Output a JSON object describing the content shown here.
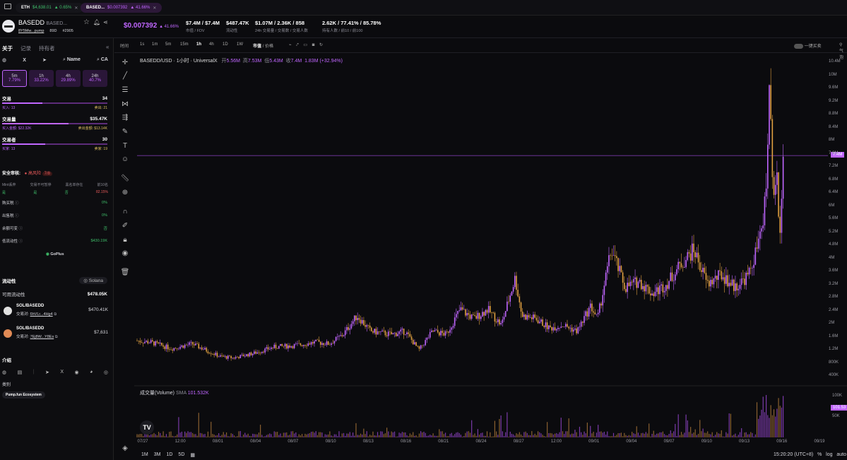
{
  "tabs": [
    {
      "symbol": "ETH",
      "price": "$4,638.01",
      "change": "▲ 0.65%"
    },
    {
      "symbol": "BASED...",
      "price": "$0.007392",
      "change": "▲ 41.66%"
    }
  ],
  "token": {
    "name": "BASEDD",
    "subname": "BASED...",
    "address": "8Y5Mw...pump",
    "age": "89D",
    "rank": "#2905"
  },
  "header": {
    "price": "$0.007392",
    "price_change": "▲ 41.66%",
    "mcap_value": "$7.4M / $7.4M",
    "mcap_label": "市值 / FDV",
    "liq_value": "$487.47K",
    "liq_label": "流动性",
    "vol_value": "$1.07M / 2.36K / 858",
    "vol_label": "24h 交易量 / 交易数 / 交易人数",
    "holders_value": "2.62K / 77.41% / 85.78%",
    "holders_label": "持有人数 / 前10 / 前100"
  },
  "sidebar": {
    "tabs": [
      "关于",
      "记录",
      "持有者"
    ],
    "social": {
      "name": "Name",
      "ca": "CA"
    },
    "timeframes": [
      {
        "label": "5m",
        "value": "7.79%"
      },
      {
        "label": "1h",
        "value": "33.22%"
      },
      {
        "label": "4h",
        "value": "29.89%"
      },
      {
        "label": "24h",
        "value": "40.7%"
      }
    ],
    "stats": [
      {
        "label": "交易",
        "value": "34",
        "left": "买入: 13",
        "right": "卖出: 21",
        "fill": 0.38
      },
      {
        "label": "交易量",
        "value": "$35.47K",
        "left": "买入金额: $22.32K",
        "right": "卖出金额: $13.14K",
        "fill": 0.63
      },
      {
        "label": "交易者",
        "value": "30",
        "left": "买家: 13",
        "right": "卖家: 19",
        "fill": 0.41
      }
    ],
    "security": {
      "title": "安全审核:",
      "badge": "高风险",
      "score": "7/8",
      "cols": [
        "Mint丢弃",
        "交易不可暂停",
        "黑名单存在",
        "前10名"
      ],
      "vals": [
        "是",
        "是",
        "否",
        "82.15%"
      ],
      "rows": [
        {
          "label": "购买税",
          "value": "0%"
        },
        {
          "label": "出售税",
          "value": "0%"
        },
        {
          "label": "余额可变",
          "value": "否"
        },
        {
          "label": "低流动性",
          "value": "$430.19K"
        }
      ],
      "provider": "GoPlus"
    },
    "liquidity": {
      "title": "流动性",
      "chain": "Solana",
      "avail_label": "可用流动性",
      "avail_value": "$478.05K",
      "pairs": [
        {
          "name": "SOL/BASEDD",
          "pair_label": "交易对:",
          "pair": "6hVLr...4Hg4",
          "value": "$470.41K"
        },
        {
          "name": "SOL/BASEDD",
          "pair_label": "交易对:",
          "pair": "7Ej8W...Y8Es",
          "value": "$7,631"
        }
      ]
    },
    "intro": {
      "title": "介绍",
      "category_label": "类别",
      "category": "Pump.fun Ecosystem"
    }
  },
  "chart_toolbar": {
    "time_label": "时间",
    "intervals": [
      "1s",
      "1m",
      "5m",
      "15m",
      "1h",
      "4h",
      "1D",
      "1W"
    ],
    "active": "1h",
    "mode": "市值",
    "mode_alt": "/ 价格",
    "quick_buy": "一键买卖",
    "bubble": "气泡"
  },
  "chart_data": {
    "type": "candlestick",
    "title": "BASEDD/USD · 1小时 · UniversalX",
    "ohlc": {
      "o_label": "开",
      "o": "5.56M",
      "h_label": "高",
      "h": "7.53M",
      "l_label": "低",
      "l": "5.43M",
      "c_label": "收",
      "c": "7.4M",
      "chg": "1.83M (+32.94%)"
    },
    "current_label": "7.4M",
    "y_ticks": [
      "10.4M",
      "10M",
      "9.6M",
      "9.2M",
      "8.8M",
      "8.4M",
      "8M",
      "7.6M",
      "7.2M",
      "6.8M",
      "6.4M",
      "6M",
      "5.6M",
      "5.2M",
      "4.8M",
      "4M",
      "3.6M",
      "3.2M",
      "2.8M",
      "2.4M",
      "2M",
      "1.6M",
      "1.2M",
      "800K",
      "400K"
    ],
    "x_ticks": [
      "07/27",
      "12:00",
      "08/01",
      "08/04",
      "08/07",
      "08/10",
      "08/13",
      "08/16",
      "08/21",
      "08/24",
      "08/27",
      "12:00",
      "09/01",
      "09/04",
      "09/07",
      "09/10",
      "09/13",
      "09/16",
      "09/19"
    ],
    "price_path": [
      [
        0,
        1.5
      ],
      [
        0.02,
        1.45
      ],
      [
        0.05,
        1.25
      ],
      [
        0.08,
        1.4
      ],
      [
        0.1,
        1.2
      ],
      [
        0.12,
        1.0
      ],
      [
        0.14,
        0.95
      ],
      [
        0.17,
        1.1
      ],
      [
        0.2,
        1.3
      ],
      [
        0.23,
        1.35
      ],
      [
        0.26,
        1.45
      ],
      [
        0.28,
        1.4
      ],
      [
        0.3,
        1.7
      ],
      [
        0.32,
        2.3
      ],
      [
        0.34,
        1.8
      ],
      [
        0.37,
        1.7
      ],
      [
        0.39,
        1.8
      ],
      [
        0.41,
        1.2
      ],
      [
        0.43,
        1.8
      ],
      [
        0.45,
        1.7
      ],
      [
        0.47,
        2.5
      ],
      [
        0.49,
        2.2
      ],
      [
        0.51,
        2.5
      ],
      [
        0.53,
        2.0
      ],
      [
        0.55,
        3.5
      ],
      [
        0.56,
        2.3
      ],
      [
        0.58,
        2.2
      ],
      [
        0.6,
        1.9
      ],
      [
        0.62,
        2.0
      ],
      [
        0.64,
        1.8
      ],
      [
        0.66,
        2.6
      ],
      [
        0.67,
        2.2
      ],
      [
        0.69,
        4.4
      ],
      [
        0.71,
        3.2
      ],
      [
        0.73,
        3.4
      ],
      [
        0.75,
        3.0
      ],
      [
        0.77,
        3.3
      ],
      [
        0.79,
        3.9
      ],
      [
        0.81,
        4.4
      ],
      [
        0.83,
        3.3
      ],
      [
        0.85,
        3.6
      ],
      [
        0.87,
        3.2
      ],
      [
        0.89,
        3.6
      ],
      [
        0.91,
        5.0
      ],
      [
        0.915,
        6.5
      ],
      [
        0.92,
        9.6
      ],
      [
        0.925,
        6.0
      ],
      [
        0.93,
        7.0
      ],
      [
        0.935,
        4.8
      ],
      [
        0.94,
        7.4
      ]
    ],
    "volume": {
      "label": "成交量(Volume)",
      "sma_label": "SMA",
      "sma": "101.532K",
      "current": "101.53"
    }
  },
  "bottom": {
    "ranges": [
      "1M",
      "3M",
      "1D",
      "5D"
    ],
    "time": "15:20:20 (UTC+8)",
    "pct": "%",
    "log": "log",
    "auto": "auto"
  }
}
